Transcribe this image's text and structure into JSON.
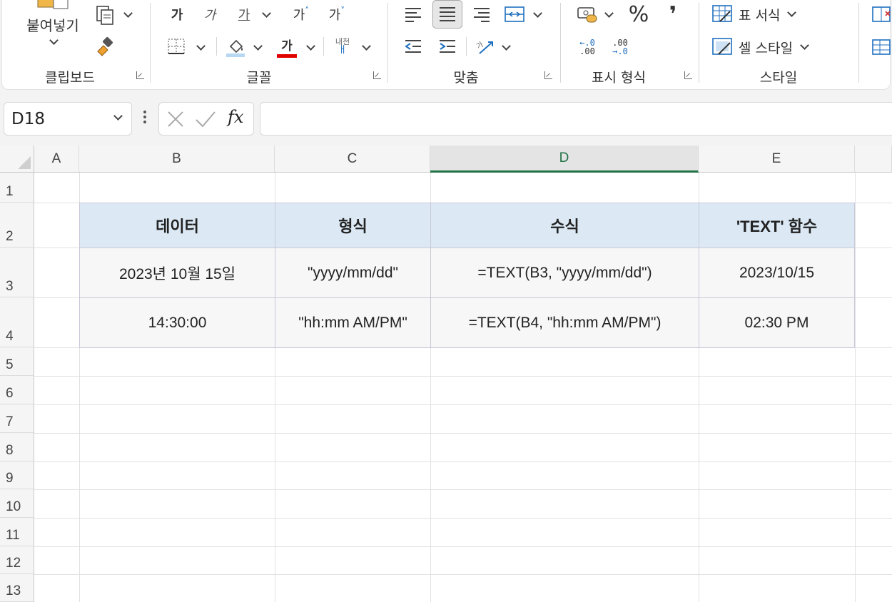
{
  "ribbon": {
    "groups": {
      "clipboard": "클립보드",
      "font": "글꼴",
      "alignment": "맞춤",
      "number": "표시 형식",
      "styles": "스타일"
    },
    "paste_label": "붙여넣기",
    "font_bold": "가",
    "font_italic": "가",
    "font_underline": "가",
    "font_grow": "가",
    "font_shrink": "가",
    "font_color_glyph": "가",
    "phonetic_top": "내천",
    "phonetic_bottom": "ㅐ",
    "percent": "%",
    "comma": "❜",
    "dec_inc_a": "←.0",
    "dec_inc_b": ".00",
    "dec_dec_a": ".00",
    "dec_dec_b": "→.0",
    "table_format": "표 서식",
    "cell_style": "셀 스타일"
  },
  "formula_bar": {
    "name_box": "D18",
    "fx": "fx",
    "formula": ""
  },
  "grid": {
    "columns": [
      "A",
      "B",
      "C",
      "D",
      "E"
    ],
    "selected_column": "D",
    "rows": [
      "1",
      "2",
      "3",
      "4",
      "5",
      "6",
      "7",
      "8",
      "9",
      "10",
      "11",
      "12",
      "13"
    ],
    "table": {
      "headers": [
        "데이터",
        "형식",
        "수식",
        "'TEXT' 함수"
      ],
      "rows": [
        [
          "2023년 10월 15일",
          "\"yyyy/mm/dd\"",
          "=TEXT(B3, \"yyyy/mm/dd\")",
          "2023/10/15"
        ],
        [
          "14:30:00",
          "\"hh:mm AM/PM\"",
          "=TEXT(B4, \"hh:mm AM/PM\")",
          "02:30 PM"
        ]
      ]
    }
  },
  "colors": {
    "header_fill": "#dce9f5",
    "body_fill": "#f7f7f8",
    "selected_column": "#217346",
    "font_color_bar": "#e00000",
    "fill_color_bar": "#b7d7f2"
  }
}
